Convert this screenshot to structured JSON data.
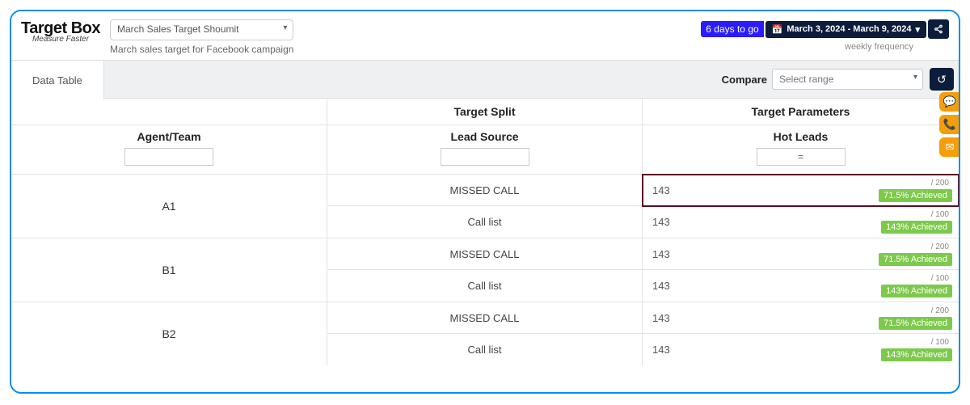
{
  "brand": {
    "main": "Target Box",
    "sub": "Measure Faster"
  },
  "header": {
    "target_select": "March Sales Target Shoumit",
    "subtitle": "March sales target for Facebook campaign",
    "days_to_go": "6 days to go",
    "date_range": "March 3, 2024 - March 9, 2024",
    "frequency": "weekly frequency"
  },
  "subbar": {
    "tab": "Data Table",
    "compare_label": "Compare",
    "compare_placeholder": "Select range"
  },
  "table": {
    "col_agent": "Agent/Team",
    "col_split_group": "Target Split",
    "col_split_sub": "Lead Source",
    "col_param_group": "Target Parameters",
    "col_param_sub": "Hot Leads",
    "param_filter_value": "=",
    "rows": [
      {
        "agent": "A1",
        "splits": [
          {
            "source": "MISSED CALL",
            "value": "143",
            "target": "/ 200",
            "achieved": "71.5% Achieved",
            "highlight": true
          },
          {
            "source": "Call list",
            "value": "143",
            "target": "/ 100",
            "achieved": "143% Achieved",
            "highlight": false
          }
        ]
      },
      {
        "agent": "B1",
        "splits": [
          {
            "source": "MISSED CALL",
            "value": "143",
            "target": "/ 200",
            "achieved": "71.5% Achieved",
            "highlight": false
          },
          {
            "source": "Call list",
            "value": "143",
            "target": "/ 100",
            "achieved": "143% Achieved",
            "highlight": false
          }
        ]
      },
      {
        "agent": "B2",
        "splits": [
          {
            "source": "MISSED CALL",
            "value": "143",
            "target": "/ 200",
            "achieved": "71.5% Achieved",
            "highlight": false
          },
          {
            "source": "Call list",
            "value": "143",
            "target": "/ 100",
            "achieved": "143% Achieved",
            "highlight": false
          }
        ]
      }
    ]
  },
  "icons": {
    "calendar": "📅",
    "share": "⚙",
    "undo": "↺",
    "chat": "💬",
    "phone": "📞",
    "mail": "✉",
    "caret": "▾"
  }
}
